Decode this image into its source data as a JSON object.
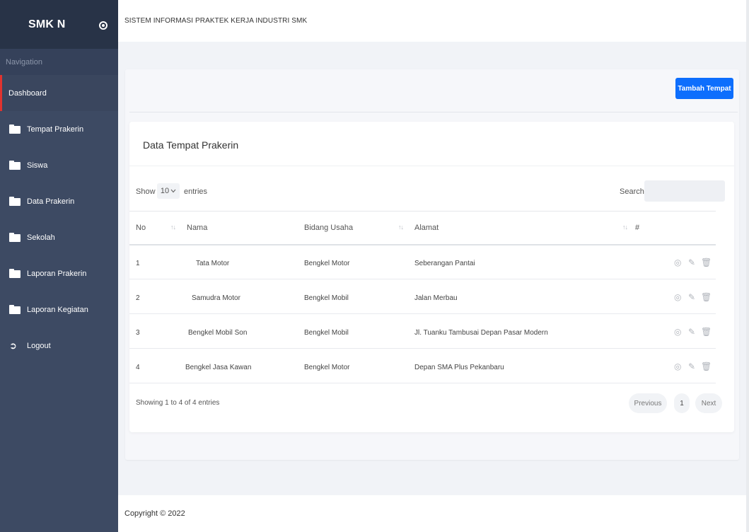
{
  "sidebar": {
    "brand": "SMK N",
    "nav_heading": "Navigation",
    "items": [
      {
        "label": "Dashboard"
      },
      {
        "label": "Tempat Prakerin"
      },
      {
        "label": "Siswa"
      },
      {
        "label": "Data Prakerin"
      },
      {
        "label": "Sekolah"
      },
      {
        "label": "Laporan Prakerin"
      },
      {
        "label": "Laporan Kegiatan"
      },
      {
        "label": "Logout"
      }
    ]
  },
  "topbar": {
    "title": "SISTEM INFORMASI PRAKTEK KERJA INDUSTRI SMK"
  },
  "main": {
    "add_button": "Tambah Tempat",
    "card_title": "Data Tempat Prakerin",
    "length": {
      "show": "Show",
      "value": "10",
      "entries": "entries"
    },
    "search_label": "Search:",
    "columns": [
      "No",
      "Nama",
      "Bidang Usaha",
      "Alamat",
      "#"
    ],
    "rows": [
      {
        "no": "1",
        "nama": "Tata Motor",
        "bidang": "Bengkel Motor",
        "alamat": "Seberangan Pantai"
      },
      {
        "no": "2",
        "nama": "Samudra Motor",
        "bidang": "Bengkel Mobil",
        "alamat": "Jalan Merbau"
      },
      {
        "no": "3",
        "nama": "Bengkel Mobil Son",
        "bidang": "Bengkel Mobil",
        "alamat": "Jl. Tuanku Tambusai Depan Pasar Modern"
      },
      {
        "no": "4",
        "nama": "Bengkel Jasa Kawan",
        "bidang": "Bengkel Motor",
        "alamat": "Depan SMA Plus Pekanbaru"
      }
    ],
    "info": "Showing 1 to 4 of 4 entries",
    "pagination": {
      "previous": "Previous",
      "page": "1",
      "next": "Next"
    }
  },
  "footer": {
    "copyright": "Copyright © 2022"
  },
  "colors": {
    "sidebar": "#3d4a63",
    "brand": "#283347",
    "primary": "#0d6efd",
    "active_marker": "#e0332f"
  }
}
